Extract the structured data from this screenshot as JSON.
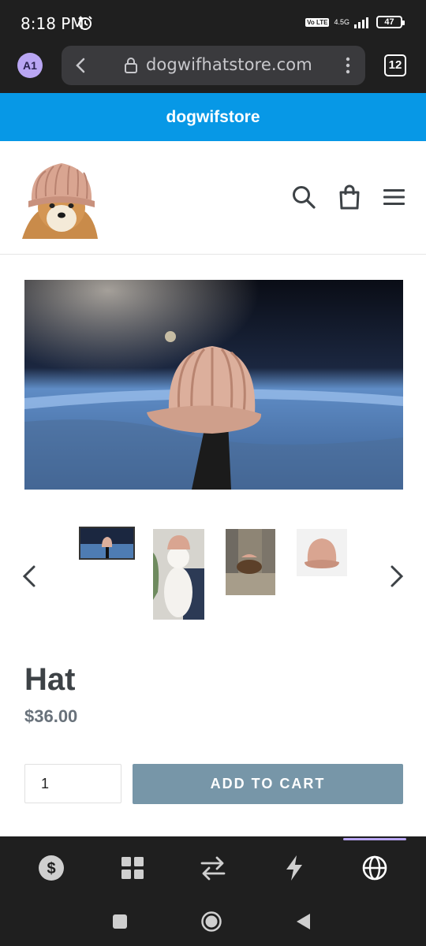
{
  "status_bar": {
    "time": "8:18 PM",
    "volte": "Vo LTE",
    "network": "4.5G",
    "battery": "47"
  },
  "browser": {
    "avatar": "A1",
    "url": "dogwifhatstore.com",
    "tab_count": "12"
  },
  "store": {
    "announcement": "dogwifstore"
  },
  "product": {
    "title": "Hat",
    "price": "$36.00",
    "quantity": "1",
    "add_to_cart": "ADD TO CART"
  },
  "colors": {
    "announcement_bg": "#0798e6",
    "button_bg": "#7796a8",
    "price": "#69727b",
    "hat": "#d9a591"
  },
  "icons": {
    "header": [
      "search-icon",
      "cart-icon",
      "menu-icon"
    ],
    "app_nav": [
      "dollar-icon",
      "grid-icon",
      "swap-icon",
      "lightning-icon",
      "globe-icon"
    ],
    "system_nav": [
      "recents-icon",
      "home-icon",
      "back-icon"
    ]
  }
}
